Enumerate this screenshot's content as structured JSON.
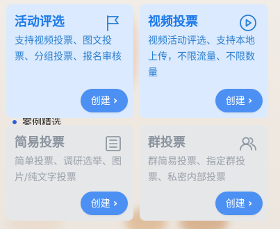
{
  "background": {
    "section_title": "案例精选"
  },
  "cards": [
    {
      "title": "活动评选",
      "desc": "支持视频投票、图文投票、分组投票、报名审核",
      "button": "创建",
      "icon": "flag-icon"
    },
    {
      "title": "视频投票",
      "desc": "视频活动评选、支持本地上传，不限流量、不限数量",
      "button": "创建",
      "icon": "play-icon"
    },
    {
      "title": "简易投票",
      "desc": "简单投票、调研选举、图片/纯文字投票",
      "button": "创建",
      "icon": "list-icon"
    },
    {
      "title": "群投票",
      "desc": "群简易投票、指定群投票、私密内部投票",
      "button": "创建",
      "icon": "group-icon"
    }
  ],
  "colors": {
    "accent": "#4c90f3",
    "card_active": "#dbeafe",
    "card_inactive": "#e6e7e9"
  }
}
